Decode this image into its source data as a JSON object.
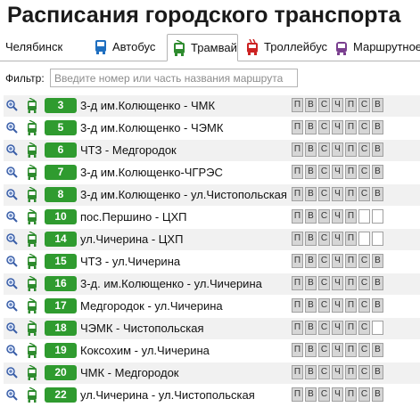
{
  "page": {
    "title": "Расписания городского транспорта"
  },
  "tabs": [
    {
      "label": "Челябинск",
      "icon": "",
      "icon_color": ""
    },
    {
      "label": "Автобус",
      "icon": "bus-icon",
      "icon_color": "#1f6fc0"
    },
    {
      "label": "Трамвай",
      "icon": "tram-icon",
      "icon_color": "#2e8b2e",
      "active": true
    },
    {
      "label": "Троллейбус",
      "icon": "trolleybus-icon",
      "icon_color": "#cc2222"
    },
    {
      "label": "Маршрутное",
      "icon": "minibus-icon",
      "icon_color": "#7a3f8f"
    }
  ],
  "filter": {
    "label": "Фильтр:",
    "placeholder": "Введите номер или часть названия маршрута",
    "value": ""
  },
  "weekdays": [
    "П",
    "В",
    "С",
    "Ч",
    "П",
    "С",
    "В"
  ],
  "routes": [
    {
      "number": "3",
      "name": "3-д им.Колющенко - ЧМК",
      "days": [
        1,
        1,
        1,
        1,
        1,
        1,
        1
      ]
    },
    {
      "number": "5",
      "name": "3-д им.Колющенко - ЧЭМК",
      "days": [
        1,
        1,
        1,
        1,
        1,
        1,
        1
      ]
    },
    {
      "number": "6",
      "name": "ЧТЗ - Медгородок",
      "days": [
        1,
        1,
        1,
        1,
        1,
        1,
        1
      ]
    },
    {
      "number": "7",
      "name": "3-д им.Колющенко-ЧГРЭС",
      "days": [
        1,
        1,
        1,
        1,
        1,
        1,
        1
      ]
    },
    {
      "number": "8",
      "name": "3-д им.Колющенко - ул.Чистопольская",
      "days": [
        1,
        1,
        1,
        1,
        1,
        1,
        1
      ]
    },
    {
      "number": "10",
      "name": "пос.Першино - ЦХП",
      "days": [
        1,
        1,
        1,
        1,
        1,
        0,
        0
      ]
    },
    {
      "number": "14",
      "name": "ул.Чичерина - ЦХП",
      "days": [
        1,
        1,
        1,
        1,
        1,
        0,
        0
      ]
    },
    {
      "number": "15",
      "name": "ЧТЗ - ул.Чичерина",
      "days": [
        1,
        1,
        1,
        1,
        1,
        1,
        1
      ]
    },
    {
      "number": "16",
      "name": "3-д. им.Колющенко - ул.Чичерина",
      "days": [
        1,
        1,
        1,
        1,
        1,
        1,
        1
      ]
    },
    {
      "number": "17",
      "name": "Медгородок - ул.Чичерина",
      "days": [
        1,
        1,
        1,
        1,
        1,
        1,
        1
      ]
    },
    {
      "number": "18",
      "name": "ЧЭМК - Чистопольская",
      "days": [
        1,
        1,
        1,
        1,
        1,
        1,
        0
      ]
    },
    {
      "number": "19",
      "name": "Коксохим - ул.Чичерина",
      "days": [
        1,
        1,
        1,
        1,
        1,
        1,
        1
      ]
    },
    {
      "number": "20",
      "name": "ЧМК - Медгородок",
      "days": [
        1,
        1,
        1,
        1,
        1,
        1,
        1
      ]
    },
    {
      "number": "22",
      "name": "ул.Чичерина - ул.Чистопольская",
      "days": [
        1,
        1,
        1,
        1,
        1,
        1,
        1
      ]
    }
  ],
  "colors": {
    "route_badge": "#2f9b2f",
    "tram_icon": "#2e8b2e"
  }
}
